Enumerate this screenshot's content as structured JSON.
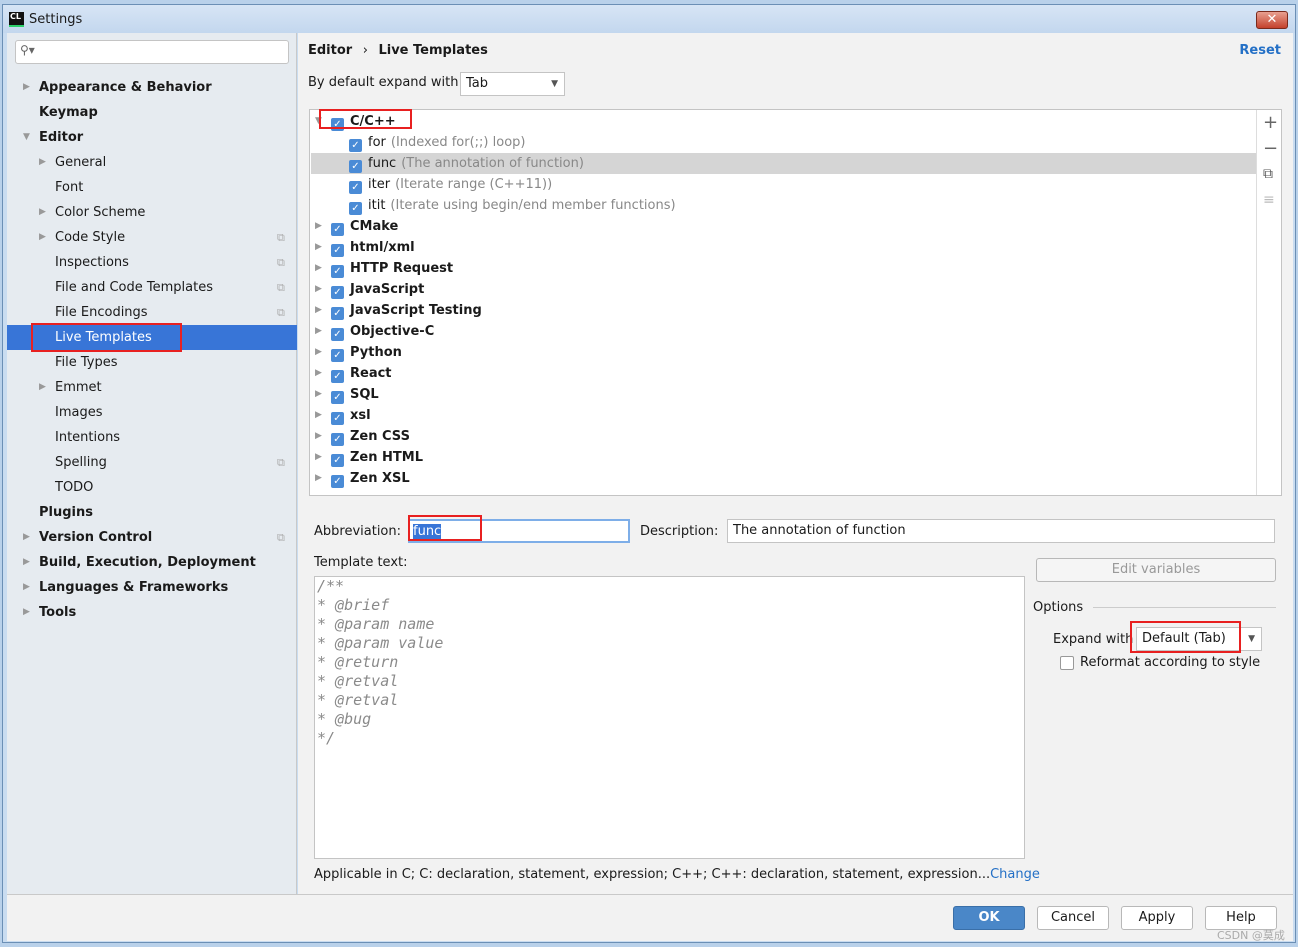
{
  "window": {
    "title": "Settings",
    "close": "✕"
  },
  "sidebar": {
    "search_placeholder": "",
    "items": [
      {
        "label": "Appearance & Behavior",
        "level": 0,
        "bold": true,
        "arrow": "▶"
      },
      {
        "label": "Keymap",
        "level": 0,
        "bold": true
      },
      {
        "label": "Editor",
        "level": 0,
        "bold": true,
        "arrow": "▼"
      },
      {
        "label": "General",
        "level": 1,
        "arrow": "▶"
      },
      {
        "label": "Font",
        "level": 1
      },
      {
        "label": "Color Scheme",
        "level": 1,
        "arrow": "▶"
      },
      {
        "label": "Code Style",
        "level": 1,
        "arrow": "▶",
        "copy": true
      },
      {
        "label": "Inspections",
        "level": 1,
        "copy": true
      },
      {
        "label": "File and Code Templates",
        "level": 1,
        "copy": true
      },
      {
        "label": "File Encodings",
        "level": 1,
        "copy": true
      },
      {
        "label": "Live Templates",
        "level": 1,
        "selected": true
      },
      {
        "label": "File Types",
        "level": 1
      },
      {
        "label": "Emmet",
        "level": 1,
        "arrow": "▶"
      },
      {
        "label": "Images",
        "level": 1
      },
      {
        "label": "Intentions",
        "level": 1
      },
      {
        "label": "Spelling",
        "level": 1,
        "copy": true
      },
      {
        "label": "TODO",
        "level": 1
      },
      {
        "label": "Plugins",
        "level": 0,
        "bold": true
      },
      {
        "label": "Version Control",
        "level": 0,
        "bold": true,
        "arrow": "▶",
        "copy": true
      },
      {
        "label": "Build, Execution, Deployment",
        "level": 0,
        "bold": true,
        "arrow": "▶"
      },
      {
        "label": "Languages & Frameworks",
        "level": 0,
        "bold": true,
        "arrow": "▶"
      },
      {
        "label": "Tools",
        "level": 0,
        "bold": true,
        "arrow": "▶"
      }
    ]
  },
  "header": {
    "breadcrumb": [
      "Editor",
      "Live Templates"
    ],
    "separator": "›",
    "reset": "Reset"
  },
  "expand_default": {
    "label": "By default expand with",
    "value": "Tab"
  },
  "templates": [
    {
      "name": "C/C++",
      "group": true,
      "expanded": true,
      "checked": true
    },
    {
      "name": "for",
      "desc": "(Indexed for(;;) loop)",
      "checked": true
    },
    {
      "name": "func",
      "desc": "(The annotation of function)",
      "checked": true,
      "selected": true
    },
    {
      "name": "iter",
      "desc": "(Iterate range (C++11))",
      "checked": true
    },
    {
      "name": "itit",
      "desc": "(Iterate using begin/end member functions)",
      "checked": true
    },
    {
      "name": "CMake",
      "group": true,
      "checked": true
    },
    {
      "name": "html/xml",
      "group": true,
      "checked": true
    },
    {
      "name": "HTTP Request",
      "group": true,
      "checked": true
    },
    {
      "name": "JavaScript",
      "group": true,
      "checked": true
    },
    {
      "name": "JavaScript Testing",
      "group": true,
      "checked": true
    },
    {
      "name": "Objective-C",
      "group": true,
      "checked": true
    },
    {
      "name": "Python",
      "group": true,
      "checked": true
    },
    {
      "name": "React",
      "group": true,
      "checked": true
    },
    {
      "name": "SQL",
      "group": true,
      "checked": true
    },
    {
      "name": "xsl",
      "group": true,
      "checked": true
    },
    {
      "name": "Zen CSS",
      "group": true,
      "checked": true
    },
    {
      "name": "Zen HTML",
      "group": true,
      "checked": true
    },
    {
      "name": "Zen XSL",
      "group": true,
      "checked": true
    }
  ],
  "toolbar": {
    "add": "+",
    "remove": "−",
    "copy": "⧉",
    "move": "≡"
  },
  "editor": {
    "abbreviation_label": "Abbreviation:",
    "abbreviation": "func",
    "description_label": "Description:",
    "description": "The annotation of function",
    "template_label": "Template text:",
    "template_text": "/**\n* @brief\n* @param name\n* @param value\n* @return\n* @retval\n* @retval\n* @bug\n*/",
    "edit_variables": "Edit variables",
    "options_label": "Options",
    "expand_with_label": "Expand with",
    "expand_with_value": "Default (Tab)",
    "reformat_label": "Reformat according to style",
    "reformat_checked": false,
    "applicable": "Applicable in C; C: declaration, statement, expression; C++; C++: declaration, statement, expression...",
    "change": "Change"
  },
  "buttons": {
    "ok": "OK",
    "cancel": "Cancel",
    "apply": "Apply",
    "help": "Help"
  },
  "watermark": "CSDN @莫成",
  "colors": {
    "accent": "#3875d7",
    "highlight_box": "#e82020",
    "link": "#2470c6"
  }
}
